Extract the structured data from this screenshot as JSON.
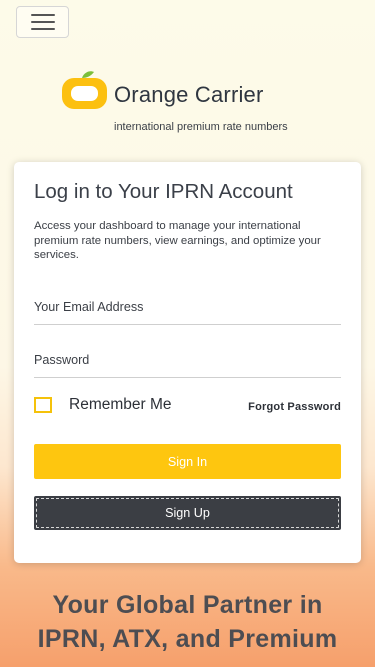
{
  "header": {
    "menu_icon": "hamburger-menu-icon"
  },
  "brand": {
    "name": "Orange Carrier",
    "tagline": "international premium rate numbers",
    "logo_icon": "orange-logo-icon",
    "logo_color": "#fcc010",
    "leaf_color": "#7cbf3a"
  },
  "login": {
    "title": "Log in to Your IPRN Account",
    "description": "Access your dashboard to manage your international premium rate numbers, view earnings, and optimize your services.",
    "email_placeholder": "Your Email Address",
    "password_placeholder": "Password",
    "remember_label": "Remember Me",
    "forgot_label": "Forgot Password",
    "signin_label": "Sign In",
    "signup_label": "Sign Up",
    "accent_color": "#fec60f",
    "dark_button_color": "#3b3e44"
  },
  "hero": {
    "line1": "Your Global Partner in",
    "line2": "IPRN, ATX, and Premium"
  }
}
